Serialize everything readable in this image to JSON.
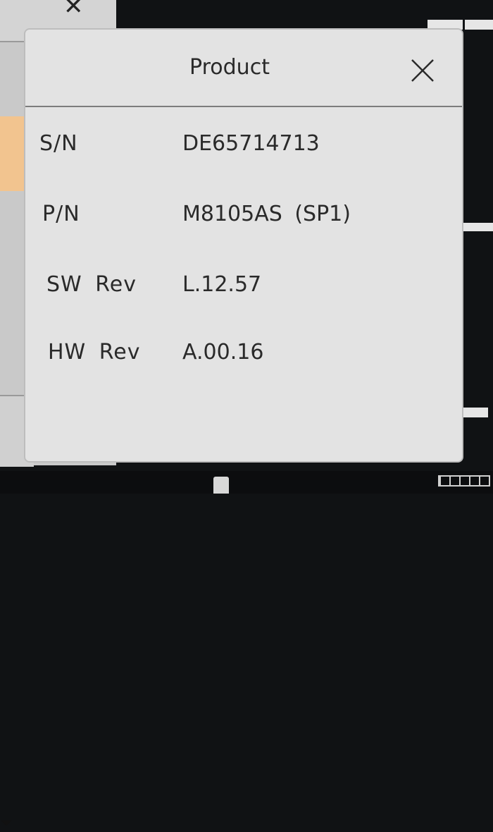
{
  "background": {
    "close_glyph": "✕",
    "scroll_glyph": "⏷"
  },
  "dialog": {
    "title": "Product",
    "close_icon": "close-icon",
    "rows": [
      {
        "label": "S/N",
        "value": "DE65714713"
      },
      {
        "label": "P/N",
        "value": "M8105AS  (SP1)"
      },
      {
        "label": "SW  Rev",
        "value": "L.12.57"
      },
      {
        "label": "HW  Rev",
        "value": "A.00.16"
      }
    ]
  },
  "colors": {
    "dialog_bg": "#e3e3e3",
    "text": "#2a2a2a",
    "highlight": "#f2c48f",
    "screen_bg": "#101214"
  }
}
